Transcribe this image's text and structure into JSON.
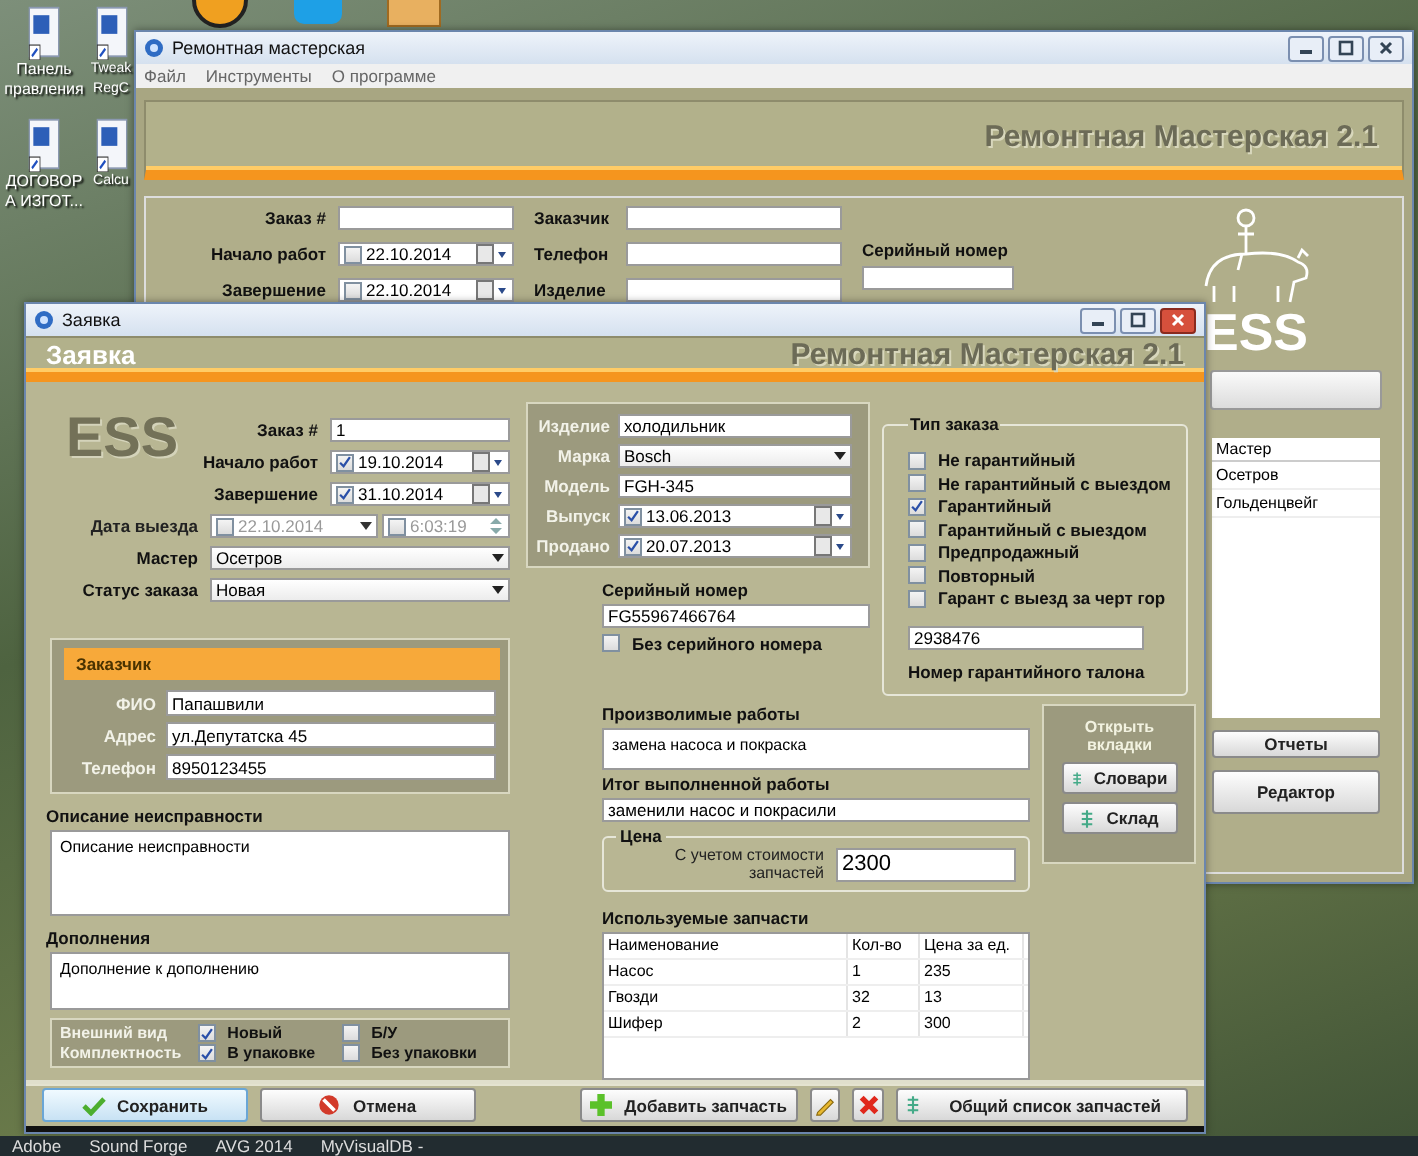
{
  "desktop": {
    "icons": [
      {
        "label": "Панель правления"
      },
      {
        "label": "Tweak RegC"
      },
      {
        "label": "ДОГОВОР А ИЗГОТ..."
      },
      {
        "label": "Calcu"
      }
    ],
    "taskbar": [
      "Adobe",
      "Sound Forge",
      "AVG 2014",
      "MyVisualDB -"
    ]
  },
  "main_window": {
    "title": "Ремонтная мастерская",
    "menu": [
      "Файл",
      "Инструменты",
      "О программе"
    ],
    "banner_title": "Ремонтная Мастерская 2.1",
    "order_fields": [
      {
        "kind": "text",
        "label": "Заказ #"
      },
      {
        "kind": "date",
        "label": "Начало работ",
        "value": "22.10.2014",
        "checked": false
      },
      {
        "kind": "date",
        "label": "Завершение",
        "value": "22.10.2014",
        "checked": false
      }
    ],
    "customer_fields": [
      {
        "label": "Заказчик"
      },
      {
        "label": "Телефон"
      },
      {
        "label": "Изделие"
      }
    ],
    "serial_label": "Серийный номер",
    "logo": "ESS",
    "masters_table": {
      "column": "Мастер",
      "rows": [
        "Осетров",
        "Гольденцвейг"
      ]
    },
    "buttons": [
      "Отчеты",
      "Редактор"
    ]
  },
  "order_dialog": {
    "title": "Заявка",
    "heading": "Заявка",
    "banner_title": "Ремонтная Мастерская 2.1",
    "logo": "ESS",
    "order_fields": [
      {
        "kind": "text",
        "label": "Заказ #",
        "value": "1"
      },
      {
        "kind": "date",
        "label": "Начало работ",
        "value": "19.10.2014",
        "checked": true
      },
      {
        "kind": "date",
        "label": "Завершение",
        "value": "31.10.2014",
        "checked": true
      },
      {
        "kind": "datetime",
        "label": "Дата выезда",
        "value": "22.10.2014",
        "time": "6:03:19",
        "checked": false,
        "disabled": true
      },
      {
        "kind": "select",
        "label": "Мастер",
        "value": "Осетров"
      },
      {
        "kind": "select",
        "label": "Статус заказа",
        "value": "Новая"
      }
    ],
    "customer": {
      "title": "Заказчик",
      "fields": [
        {
          "label": "ФИО",
          "value": "Папашвили"
        },
        {
          "label": "Адрес",
          "value": "ул.Депутатска 45"
        },
        {
          "label": "Телефон",
          "value": "8950123455"
        }
      ]
    },
    "fault": {
      "label": "Описание неисправности",
      "value": "Описание неисправности"
    },
    "notes": {
      "label": "Дополнения",
      "value": "Дополнение к дополнению"
    },
    "condition": {
      "labels": [
        "Внешний вид",
        "Комплектность"
      ],
      "options": [
        {
          "label": "Новый",
          "checked": true
        },
        {
          "label": "Б/У",
          "checked": false
        },
        {
          "label": "В упаковке",
          "checked": true
        },
        {
          "label": "Без упаковки",
          "checked": false
        }
      ]
    },
    "item_fields": [
      {
        "kind": "text",
        "label": "Изделие",
        "value": "холодильник"
      },
      {
        "kind": "select",
        "label": "Марка",
        "value": "Bosch"
      },
      {
        "kind": "text",
        "label": "Модель",
        "value": "FGH-345"
      },
      {
        "kind": "date",
        "label": "Выпуск",
        "value": "13.06.2013",
        "checked": true
      },
      {
        "kind": "date",
        "label": "Продано",
        "value": "20.07.2013",
        "checked": true
      }
    ],
    "serial": {
      "label": "Серийный номер",
      "value": "FG55967466764"
    },
    "no_serial": {
      "label": "Без серийного номера",
      "checked": false
    },
    "works": {
      "label": "Произволимые работы",
      "value": "замена насоса и покраска"
    },
    "result": {
      "label": "Итог выполненной работы",
      "value": "заменили насос и покрасили"
    },
    "price": {
      "legend": "Цена",
      "label": "С учетом стоимости запчастей",
      "value": "2300"
    },
    "order_type": {
      "legend": "Тип заказа",
      "options": [
        {
          "label": "Не гарантийный",
          "checked": false
        },
        {
          "label": "Не гарантийный с выездом",
          "checked": false
        },
        {
          "label": "Гарантийный",
          "checked": true
        },
        {
          "label": "Гарантийный с выездом",
          "checked": false
        },
        {
          "label": "Предпродажный",
          "checked": false
        },
        {
          "label": "Повторный",
          "checked": false
        },
        {
          "label": "Гарант с выезд за черт гор",
          "checked": false
        }
      ],
      "warranty_number": "2938476",
      "warranty_label": "Номер гарантийного талона"
    },
    "tabs_panel": {
      "title": "Открыть вкладки",
      "buttons": [
        "Словари",
        "Склад"
      ]
    },
    "parts": {
      "label": "Используемые запчасти",
      "columns": [
        "Наименование",
        "Кол-во",
        "Цена за ед."
      ],
      "rows": [
        [
          "Насос",
          "1",
          "235"
        ],
        [
          "Гвозди",
          "32",
          "13"
        ],
        [
          "Шифер",
          "2",
          "300"
        ]
      ]
    },
    "buttons": [
      {
        "kind": "save",
        "label": "Сохранить"
      },
      {
        "kind": "cancel",
        "label": "Отмена"
      },
      {
        "kind": "add",
        "label": "Добавить запчасть"
      },
      {
        "kind": "edit"
      },
      {
        "kind": "delete"
      },
      {
        "kind": "list",
        "label": "Общий список запчастей"
      }
    ]
  }
}
